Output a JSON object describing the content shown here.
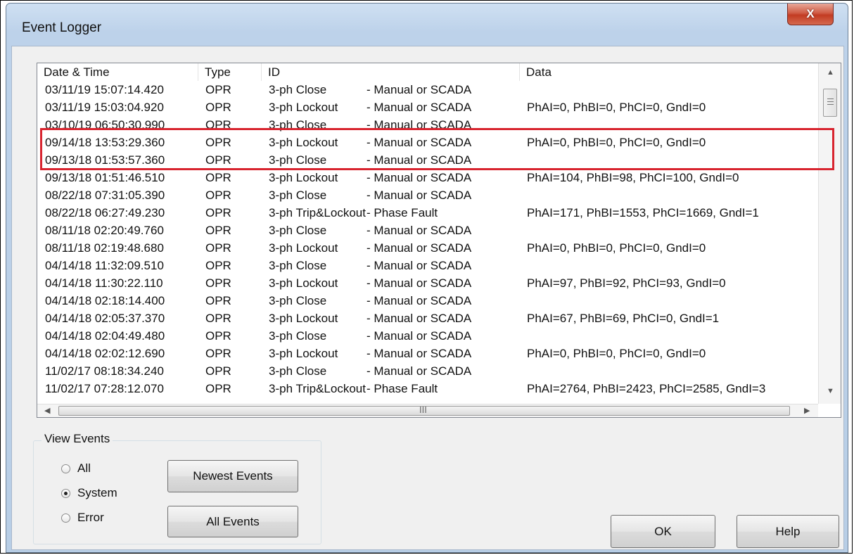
{
  "window": {
    "title": "Event Logger",
    "close_glyph": "X"
  },
  "list": {
    "headers": {
      "date": "Date & Time",
      "type": "Type",
      "id": "ID",
      "data": "Data"
    },
    "rows": [
      {
        "date": "03/11/19 15:07:14.420",
        "type": "OPR",
        "id": "3-ph Close",
        "reason": "- Manual or SCADA",
        "data": ""
      },
      {
        "date": "03/11/19 15:03:04.920",
        "type": "OPR",
        "id": "3-ph Lockout",
        "reason": "- Manual or SCADA",
        "data": "PhAI=0, PhBI=0, PhCI=0, GndI=0"
      },
      {
        "date": "03/10/19 06:50:30.990",
        "type": "OPR",
        "id": "3-ph Close",
        "reason": "- Manual or SCADA",
        "data": ""
      },
      {
        "date": "09/14/18 13:53:29.360",
        "type": "OPR",
        "id": "3-ph Lockout",
        "reason": "- Manual or SCADA",
        "data": "PhAI=0, PhBI=0, PhCI=0, GndI=0"
      },
      {
        "date": "09/13/18 01:53:57.360",
        "type": "OPR",
        "id": "3-ph Close",
        "reason": "- Manual or SCADA",
        "data": ""
      },
      {
        "date": "09/13/18 01:51:46.510",
        "type": "OPR",
        "id": "3-ph Lockout",
        "reason": "- Manual or SCADA",
        "data": "PhAI=104, PhBI=98, PhCI=100, GndI=0"
      },
      {
        "date": "08/22/18 07:31:05.390",
        "type": "OPR",
        "id": "3-ph Close",
        "reason": "- Manual or SCADA",
        "data": ""
      },
      {
        "date": "08/22/18 06:27:49.230",
        "type": "OPR",
        "id": "3-ph Trip&Lockout",
        "reason": "- Phase Fault",
        "data": "PhAI=171, PhBI=1553, PhCI=1669, GndI=1"
      },
      {
        "date": "08/11/18 02:20:49.760",
        "type": "OPR",
        "id": "3-ph Close",
        "reason": "- Manual or SCADA",
        "data": ""
      },
      {
        "date": "08/11/18 02:19:48.680",
        "type": "OPR",
        "id": "3-ph Lockout",
        "reason": "- Manual or SCADA",
        "data": "PhAI=0, PhBI=0, PhCI=0, GndI=0"
      },
      {
        "date": "04/14/18 11:32:09.510",
        "type": "OPR",
        "id": "3-ph Close",
        "reason": "- Manual or SCADA",
        "data": ""
      },
      {
        "date": "04/14/18 11:30:22.110",
        "type": "OPR",
        "id": "3-ph Lockout",
        "reason": "- Manual or SCADA",
        "data": "PhAI=97, PhBI=92, PhCI=93, GndI=0"
      },
      {
        "date": "04/14/18 02:18:14.400",
        "type": "OPR",
        "id": "3-ph Close",
        "reason": "- Manual or SCADA",
        "data": ""
      },
      {
        "date": "04/14/18 02:05:37.370",
        "type": "OPR",
        "id": "3-ph Lockout",
        "reason": "- Manual or SCADA",
        "data": "PhAI=67, PhBI=69, PhCI=0, GndI=1"
      },
      {
        "date": "04/14/18 02:04:49.480",
        "type": "OPR",
        "id": "3-ph Close",
        "reason": "- Manual or SCADA",
        "data": ""
      },
      {
        "date": "04/14/18 02:02:12.690",
        "type": "OPR",
        "id": "3-ph Lockout",
        "reason": "- Manual or SCADA",
        "data": "PhAI=0, PhBI=0, PhCI=0, GndI=0"
      },
      {
        "date": "11/02/17 08:18:34.240",
        "type": "OPR",
        "id": "3-ph Close",
        "reason": "- Manual or SCADA",
        "data": ""
      },
      {
        "date": "11/02/17 07:28:12.070",
        "type": "OPR",
        "id": "3-ph Trip&Lockout",
        "reason": "- Phase Fault",
        "data": "PhAI=2764, PhBI=2423, PhCI=2585, GndI=3"
      }
    ],
    "hscroll_grip": "III"
  },
  "view_events": {
    "legend": "View Events",
    "options": [
      {
        "label": "All",
        "checked": false
      },
      {
        "label": "System",
        "checked": true
      },
      {
        "label": "Error",
        "checked": false
      }
    ],
    "newest_button": "Newest Events",
    "all_button": "All Events"
  },
  "footer": {
    "ok_button": "OK",
    "help_button": "Help"
  }
}
